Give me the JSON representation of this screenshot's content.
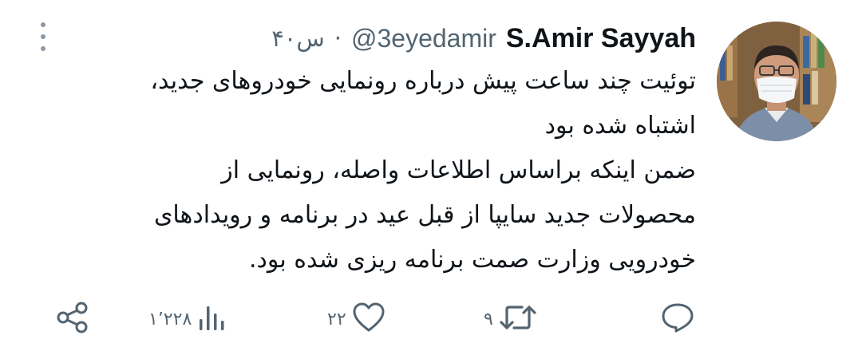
{
  "tweet": {
    "author_name": "S.Amir Sayyah",
    "handle": "@3eyedamir",
    "separator": "·",
    "time": "۴۰س",
    "text_lines": [
      "توئیت چند ساعت پیش درباره رونمایی خودروهای جدید،",
      "اشتباه شده بود",
      "ضمن اینکه براساس اطلاعات واصله، رونمایی از",
      "محصولات جدید سایپا از قبل عید در برنامه و رویدادهای",
      "خودرویی وزارت صمت برنامه ریزی شده بود."
    ]
  },
  "actions": {
    "reply_count": "",
    "retweet_count": "۹",
    "like_count": "۲۲",
    "views_count": "۱٬۲۲۸"
  },
  "icons": {
    "more": "more-vertical-icon",
    "reply": "reply-icon",
    "retweet": "retweet-icon",
    "like": "heart-icon",
    "views": "views-icon",
    "share": "share-icon"
  },
  "colors": {
    "text": "#0f1419",
    "secondary": "#536471",
    "icon": "#536471",
    "more_dots": "#8b98a5"
  }
}
